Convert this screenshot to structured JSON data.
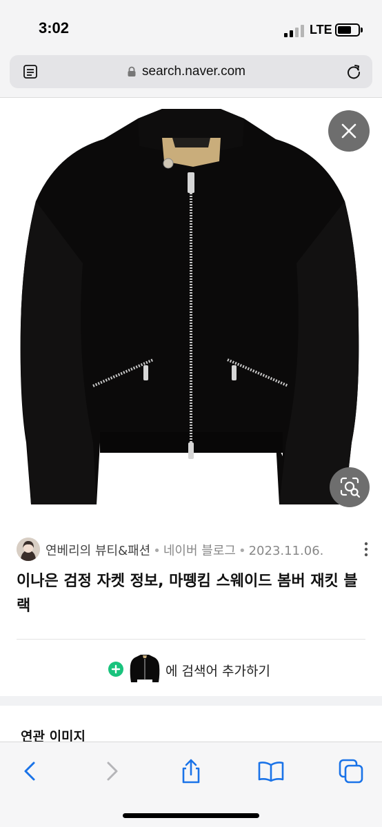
{
  "status_bar": {
    "time": "3:02",
    "network": "LTE",
    "icons": [
      "signal-icon",
      "battery-icon"
    ]
  },
  "browser": {
    "url": "search.naver.com",
    "icons": [
      "reader-icon",
      "lock-icon",
      "reload-icon"
    ]
  },
  "viewer": {
    "image_subject": "black jacket with silver zippers",
    "buttons": [
      "close-icon",
      "image-search-icon"
    ]
  },
  "result": {
    "author": "연베리의 뷰티&패션",
    "separator": "•",
    "source": "네이버 블로그",
    "date": "2023.11.06.",
    "title": "이나은 검정 자켓 정보, 마뗑킴 스웨이드 봄버 재킷 블랙"
  },
  "add_keyword": {
    "label": "에 검색어 추가하기"
  },
  "related": {
    "heading": "연관 이미지"
  },
  "toolbar": {
    "items": [
      "back-icon",
      "forward-icon",
      "share-icon",
      "bookmarks-icon",
      "tabs-icon"
    ]
  },
  "colors": {
    "accent_blue": "#1a73e8",
    "add_green": "#19c37d",
    "overlay_gray": "#6e6e6e"
  }
}
